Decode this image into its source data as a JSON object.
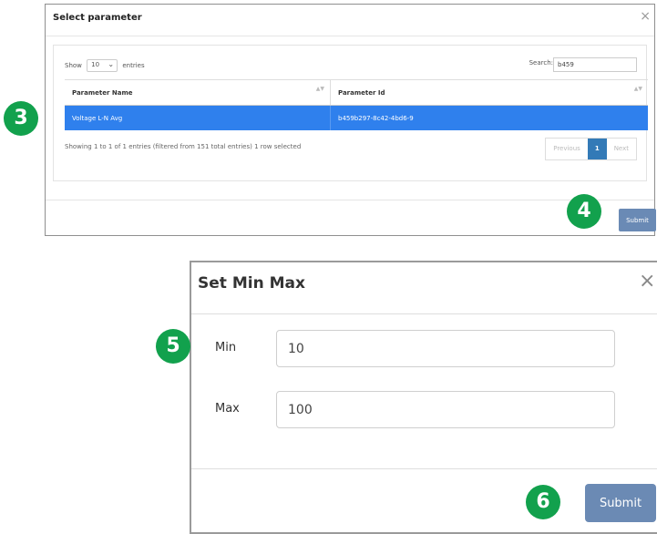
{
  "select_parameter_modal": {
    "title": "Select parameter",
    "close": "×",
    "show_prefix": "Show",
    "page_length": "10",
    "show_suffix": "entries",
    "search_label": "Search:",
    "search_value": "b459",
    "columns": [
      "Parameter Name",
      "Parameter Id"
    ],
    "rows": [
      {
        "name": "Voltage L-N Avg",
        "id": "b459b297-8c42-4bd6-9",
        "selected": true
      }
    ],
    "info": "Showing 1 to 1 of 1 entries (filtered from 151 total entries)   1 row selected",
    "pagination": {
      "previous": "Previous",
      "current": "1",
      "next": "Next"
    },
    "submit_label": "Submit"
  },
  "set_min_max_modal": {
    "title": "Set Min Max",
    "close": "×",
    "min_label": "Min",
    "min_value": "10",
    "max_label": "Max",
    "max_value": "100",
    "submit_label": "Submit"
  },
  "step_badges": [
    "3",
    "4",
    "5",
    "6"
  ],
  "colors": {
    "badge_green": "#12a14d",
    "selected_row": "#2f80ed",
    "submit_button": "#6a8ab5",
    "pagination_active": "#337ab7"
  }
}
